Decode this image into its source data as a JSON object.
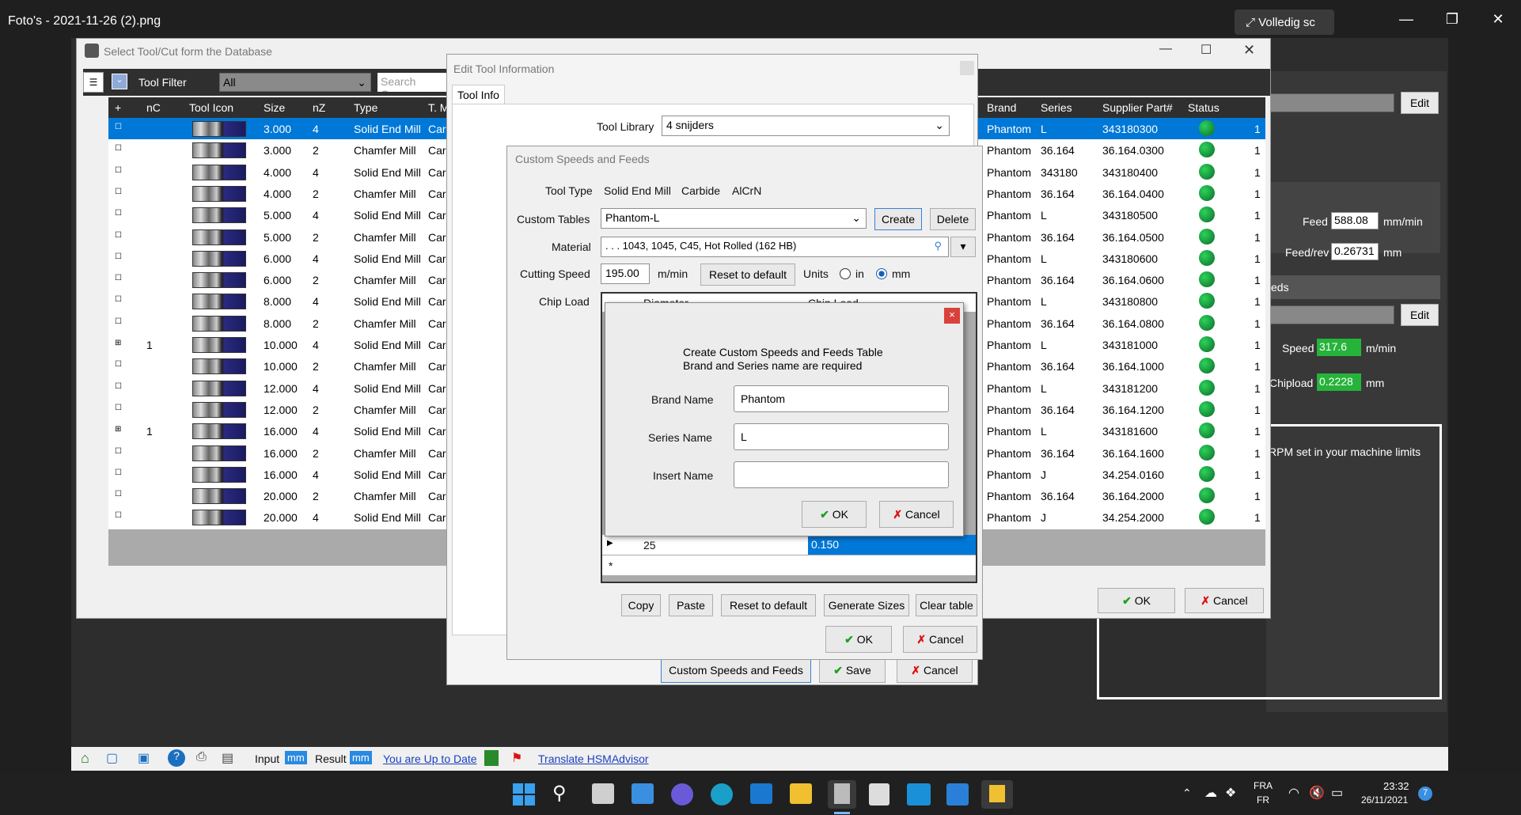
{
  "viewer": {
    "title": "Foto's - 2021-11-26 (2).png",
    "fullscreen_label": "Volledig sc"
  },
  "main_window": {
    "title": "Select Tool/Cut form the Database",
    "filter_label": "Tool Filter",
    "filter_value": "All",
    "search_placeholder": "Search Comm",
    "columns": [
      "+",
      "nC",
      "Tool Icon",
      "Size",
      "nZ",
      "Type",
      "T. M"
    ],
    "right_columns": [
      "Brand",
      "Series",
      "Supplier Part#",
      "Status"
    ],
    "rows": [
      {
        "nc": "",
        "size": "3.000",
        "nz": "4",
        "type": "Solid End Mill",
        "mat": "Carb",
        "brand": "Phantom",
        "series": "L",
        "part": "343180300",
        "more": "1"
      },
      {
        "nc": "",
        "size": "3.000",
        "nz": "2",
        "type": "Chamfer Mill",
        "mat": "Carb",
        "brand": "Phantom",
        "series": "36.164",
        "part": "36.164.0300",
        "more": "1"
      },
      {
        "nc": "",
        "size": "4.000",
        "nz": "4",
        "type": "Solid End Mill",
        "mat": "Carb",
        "brand": "Phantom",
        "series": "343180",
        "part": "343180400",
        "more": "1"
      },
      {
        "nc": "",
        "size": "4.000",
        "nz": "2",
        "type": "Chamfer Mill",
        "mat": "Carb",
        "brand": "Phantom",
        "series": "36.164",
        "part": "36.164.0400",
        "more": "1"
      },
      {
        "nc": "",
        "size": "5.000",
        "nz": "4",
        "type": "Solid End Mill",
        "mat": "Carb",
        "brand": "Phantom",
        "series": "L",
        "part": "343180500",
        "more": "1"
      },
      {
        "nc": "",
        "size": "5.000",
        "nz": "2",
        "type": "Chamfer Mill",
        "mat": "Carb",
        "brand": "Phantom",
        "series": "36.164",
        "part": "36.164.0500",
        "more": "1"
      },
      {
        "nc": "",
        "size": "6.000",
        "nz": "4",
        "type": "Solid End Mill",
        "mat": "Carb",
        "brand": "Phantom",
        "series": "L",
        "part": "343180600",
        "more": "1"
      },
      {
        "nc": "",
        "size": "6.000",
        "nz": "2",
        "type": "Chamfer Mill",
        "mat": "Carb",
        "brand": "Phantom",
        "series": "36.164",
        "part": "36.164.0600",
        "more": "1"
      },
      {
        "nc": "",
        "size": "8.000",
        "nz": "4",
        "type": "Solid End Mill",
        "mat": "Carb",
        "brand": "Phantom",
        "series": "L",
        "part": "343180800",
        "more": "1"
      },
      {
        "nc": "",
        "size": "8.000",
        "nz": "2",
        "type": "Chamfer Mill",
        "mat": "Carb",
        "brand": "Phantom",
        "series": "36.164",
        "part": "36.164.0800",
        "more": "1"
      },
      {
        "nc": "1",
        "size": "10.000",
        "nz": "4",
        "type": "Solid End Mill",
        "mat": "Carb",
        "brand": "Phantom",
        "series": "L",
        "part": "343181000",
        "more": "1"
      },
      {
        "nc": "",
        "size": "10.000",
        "nz": "2",
        "type": "Chamfer Mill",
        "mat": "Carb",
        "brand": "Phantom",
        "series": "36.164",
        "part": "36.164.1000",
        "more": "1"
      },
      {
        "nc": "",
        "size": "12.000",
        "nz": "4",
        "type": "Solid End Mill",
        "mat": "Carb",
        "brand": "Phantom",
        "series": "L",
        "part": "343181200",
        "more": "1"
      },
      {
        "nc": "",
        "size": "12.000",
        "nz": "2",
        "type": "Chamfer Mill",
        "mat": "Carb",
        "brand": "Phantom",
        "series": "36.164",
        "part": "36.164.1200",
        "more": "1"
      },
      {
        "nc": "1",
        "size": "16.000",
        "nz": "4",
        "type": "Solid End Mill",
        "mat": "Carb",
        "brand": "Phantom",
        "series": "L",
        "part": "343181600",
        "more": "1"
      },
      {
        "nc": "",
        "size": "16.000",
        "nz": "2",
        "type": "Chamfer Mill",
        "mat": "Carb",
        "brand": "Phantom",
        "series": "36.164",
        "part": "36.164.1600",
        "more": "1"
      },
      {
        "nc": "",
        "size": "16.000",
        "nz": "4",
        "type": "Solid End Mill",
        "mat": "Carb",
        "brand": "Phantom",
        "series": "J",
        "part": "34.254.0160",
        "more": "1"
      },
      {
        "nc": "",
        "size": "20.000",
        "nz": "2",
        "type": "Chamfer Mill",
        "mat": "Carb",
        "brand": "Phantom",
        "series": "36.164",
        "part": "36.164.2000",
        "more": "1"
      },
      {
        "nc": "",
        "size": "20.000",
        "nz": "4",
        "type": "Solid End Mill",
        "mat": "Carb",
        "brand": "Phantom",
        "series": "J",
        "part": "34.254.2000",
        "more": "1"
      }
    ],
    "ok": "OK",
    "cancel": "Cancel"
  },
  "right_panel": {
    "edit": "Edit",
    "feed_label": "Feed",
    "feed_value": "588.08",
    "feed_unit": "mm/min",
    "feedrev_label": "Feed/rev",
    "feedrev_value": "0.26731",
    "feedrev_unit": "mm",
    "section": "eds",
    "edit2": "Edit",
    "speed_label": "Speed",
    "speed_value": "317.6",
    "speed_unit": "m/min",
    "chipload_label": "Chipload",
    "chipload_value": "0.2228",
    "chipload_unit": "mm",
    "rpm_note": "RPM set in your machine limits"
  },
  "edit_tool": {
    "title": "Edit Tool Information",
    "tab": "Tool Info",
    "library_label": "Tool Library",
    "library_value": "4 snijders",
    "custom_speeds_btn": "Custom Speeds and Feeds",
    "save": "Save",
    "cancel": "Cancel"
  },
  "custom_speeds": {
    "title": "Custom Speeds and Feeds",
    "tooltype_label": "Tool Type",
    "tooltype_1": "Solid End Mill",
    "tooltype_2": "Carbide",
    "tooltype_3": "AlCrN",
    "tables_label": "Custom Tables",
    "tables_value": "Phantom-L",
    "create": "Create",
    "delete": "Delete",
    "material_label": "Material",
    "material_value": ". . . 1043, 1045, C45, Hot Rolled  (162 HB)",
    "speed_label": "Cutting Speed",
    "speed_value": "195.00",
    "speed_unit": "m/min",
    "reset": "Reset to default",
    "units_label": "Units",
    "unit_in": "in",
    "unit_mm": "mm",
    "chipload_label": "Chip Load",
    "col_diameter": "Diameter",
    "col_chipload": "Chip Load",
    "last_diameter": "25",
    "last_chipload": "0.150",
    "new_row_marker": "*",
    "copy": "Copy",
    "paste": "Paste",
    "reset2": "Reset to default",
    "generate": "Generate Sizes",
    "clear": "Clear table",
    "ok": "OK",
    "cancel": "Cancel"
  },
  "create_dialog": {
    "line1": "Create Custom Speeds and Feeds Table",
    "line2": "Brand and Series name are required",
    "brand_label": "Brand Name",
    "brand_value": "Phantom",
    "series_label": "Series Name",
    "series_value": "L",
    "insert_label": "Insert Name",
    "insert_value": "",
    "ok": "OK",
    "cancel": "Cancel"
  },
  "statusbar": {
    "input": "Input",
    "input_unit": "mm",
    "result": "Result",
    "result_unit": "mm",
    "update": "You are Up to Date",
    "translate": "Translate HSMAdvisor"
  },
  "taskbar": {
    "lang1": "FRA",
    "lang2": "FR",
    "time": "23:32",
    "date": "26/11/2021",
    "badge": "7"
  },
  "colors": {
    "selection": "#0078d7",
    "ok_green": "#1da11d",
    "cancel_red": "#d11111",
    "panel_dark": "#383838"
  }
}
